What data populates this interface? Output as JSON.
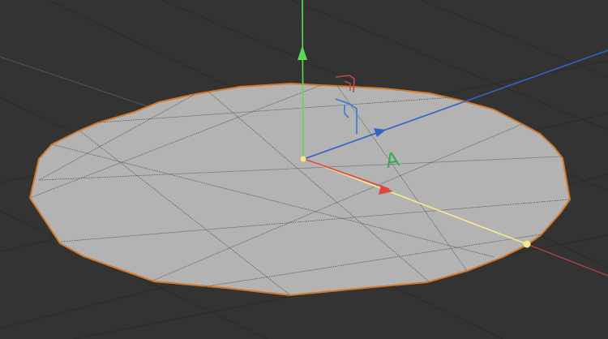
{
  "viewport": {
    "background_color": "#333333",
    "grid_line_color": "#2a2a2a",
    "grid_axis_color": "#555555"
  },
  "disc": {
    "fill_color": "#b3b3b3",
    "outline_color": "#d27a2c",
    "wire_color": "#555555"
  },
  "axes": {
    "y_axis_color": "#58dc58",
    "x_axis_color": "#e04444",
    "z_axis_color": "#2f63c4",
    "radius_handle_color": "#f5e98c"
  },
  "gizmo_labels": {
    "radius_label": "A",
    "radius_label_color": "#3aa85a",
    "plane_y_color": "#3a78d8",
    "plane_x_color": "#c04848"
  },
  "icons": {
    "y_arrow": "arrow-up-icon",
    "x_arrow": "arrow-right-icon",
    "z_arrow": "arrow-right-icon",
    "plane_handle": "plane-handle-icon"
  }
}
